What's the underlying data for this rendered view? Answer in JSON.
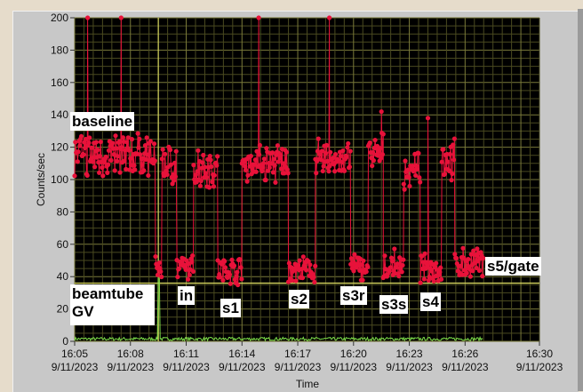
{
  "chart_data": {
    "type": "line",
    "xlabel": "Time",
    "ylabel": "Counts/sec",
    "ylim": [
      0,
      200
    ],
    "xlim_minutes": [
      "16:05",
      "16:30"
    ],
    "yticks": [
      "0",
      "20",
      "40",
      "60",
      "80",
      "100",
      "120",
      "140",
      "160",
      "180",
      "200"
    ],
    "xticks": [
      {
        "time": "16:05",
        "date": "9/11/2023"
      },
      {
        "time": "16:08",
        "date": "9/11/2023"
      },
      {
        "time": "16:11",
        "date": "9/11/2023"
      },
      {
        "time": "16:14",
        "date": "9/11/2023"
      },
      {
        "time": "16:17",
        "date": "9/11/2023"
      },
      {
        "time": "16:20",
        "date": "9/11/2023"
      },
      {
        "time": "16:23",
        "date": "9/11/2023"
      },
      {
        "time": "16:26",
        "date": "9/11/2023"
      },
      {
        "time": "16:30",
        "date": "9/11/2023"
      }
    ],
    "grid": true,
    "cursor_level": 36,
    "cursor_time": "16:09.5",
    "series": [
      {
        "name": "red",
        "color": "#e8123a",
        "segments_min_from_1605": [
          {
            "start": 0,
            "end": 4.35,
            "level": 115,
            "spread": 10
          },
          {
            "start": 4.35,
            "end": 4.7,
            "level": 45,
            "spread": 5
          },
          {
            "start": 4.7,
            "end": 5.5,
            "level": 110,
            "spread": 10
          },
          {
            "start": 5.5,
            "end": 6.4,
            "level": 45,
            "spread": 6
          },
          {
            "start": 6.4,
            "end": 7.7,
            "level": 108,
            "spread": 10
          },
          {
            "start": 7.7,
            "end": 9.0,
            "level": 44,
            "spread": 6
          },
          {
            "start": 9.0,
            "end": 11.5,
            "level": 110,
            "spread": 9
          },
          {
            "start": 11.5,
            "end": 12.95,
            "level": 44,
            "spread": 6
          },
          {
            "start": 12.95,
            "end": 14.85,
            "level": 112,
            "spread": 9
          },
          {
            "start": 14.85,
            "end": 15.8,
            "level": 46,
            "spread": 6
          },
          {
            "start": 15.8,
            "end": 16.6,
            "level": 115,
            "spread": 10
          },
          {
            "start": 16.6,
            "end": 17.7,
            "level": 46,
            "spread": 7
          },
          {
            "start": 17.7,
            "end": 18.6,
            "level": 105,
            "spread": 9
          },
          {
            "start": 18.6,
            "end": 19.75,
            "level": 45,
            "spread": 6
          },
          {
            "start": 19.75,
            "end": 20.45,
            "level": 112,
            "spread": 9
          },
          {
            "start": 20.45,
            "end": 22.0,
            "level": 48,
            "spread": 7
          }
        ],
        "spikes": [
          {
            "t": 0.7,
            "v": 200
          },
          {
            "t": 2.5,
            "v": 200
          },
          {
            "t": 9.9,
            "v": 200
          },
          {
            "t": 13.7,
            "v": 200
          },
          {
            "t": 16.5,
            "v": 142
          },
          {
            "t": 19.0,
            "v": 138
          }
        ]
      },
      {
        "name": "green",
        "color": "#7ee04a",
        "level": 1.5,
        "spike": {
          "t": 4.5,
          "v": 45
        },
        "end": 22.0
      }
    ],
    "annotations": [
      "baseline",
      "beamtube GV",
      "in",
      "s1",
      "s2",
      "s3r",
      "s3s",
      "s4",
      "s5/gate"
    ]
  }
}
